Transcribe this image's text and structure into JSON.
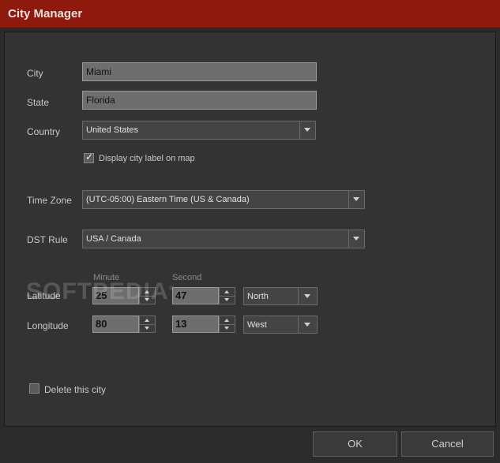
{
  "window": {
    "title": "City Manager"
  },
  "form": {
    "city_label": "City",
    "city_value": "Miami",
    "state_label": "State",
    "state_value": "Florida",
    "country_label": "Country",
    "country_value": "United States",
    "display_label_text": "Display city label on map",
    "display_label_checked": true,
    "timezone_label": "Time Zone",
    "timezone_value": "(UTC-05:00) Eastern Time (US & Canada)",
    "dst_label": "DST Rule",
    "dst_value": "USA / Canada",
    "minute_header": "Minute",
    "second_header": "Second",
    "latitude_label": "Latitude",
    "latitude_minute": "25",
    "latitude_second": "47",
    "latitude_dir": "North",
    "longitude_label": "Longitude",
    "longitude_minute": "80",
    "longitude_second": "13",
    "longitude_dir": "West",
    "delete_text": "Delete this city",
    "delete_checked": false
  },
  "buttons": {
    "ok": "OK",
    "cancel": "Cancel"
  },
  "watermark": {
    "text": "SOFTPEDIA",
    "mark": "®"
  },
  "colors": {
    "titlebar": "#8e1a0e",
    "panel": "#333333",
    "background": "#2b2b2b"
  }
}
